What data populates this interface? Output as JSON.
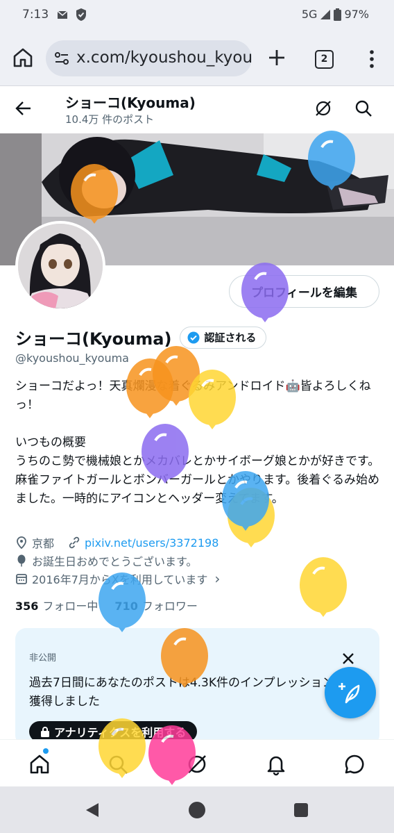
{
  "status_bar": {
    "time": "7:13",
    "network": "5G",
    "battery": "97%"
  },
  "browser": {
    "url": "x.com/kyoushou_kyouma",
    "tab_count": "2"
  },
  "profile_header": {
    "name": "ショーコ(Kyouma)",
    "post_count": "10.4万 件のポスト"
  },
  "profile": {
    "edit_button": "プロフィールを編集",
    "display_name": "ショーコ(Kyouma)",
    "verified_label": "認証される",
    "handle": "@kyoushou_kyouma",
    "bio_line1": "ショーコだよっ！天真爛漫な着ぐるみアンドロイド🤖皆よろしくねっ！",
    "bio_line2": "いつもの概要",
    "bio_line3": "うちのこ勢で機械娘とかメカバレとかサイボーグ娘とかが好きです。麻雀ファイトガールとボンバーガールとかやります。後着ぐるみ始めました。一時的にアイコンとヘッダー変えてます。",
    "location": "京都",
    "website": "pixiv.net/users/3372198",
    "birthday": "お誕生日おめでとうございます。",
    "joined": "2016年7月からXを利用しています",
    "following_count": "356",
    "following_label": "フォロー中",
    "followers_count": "710",
    "followers_label": "フォロワー"
  },
  "analytics_card": {
    "label": "非公開",
    "text": "過去7日間にあなたのポストは4.3K件のインプレッションを獲得しました",
    "button": "アナリティクスを利用する"
  },
  "colors": {
    "accent": "#1d9bf0",
    "card_bg": "#e8f5fd",
    "balloon_orange": "#f7931e",
    "balloon_blue": "#3ea6f0",
    "balloon_purple": "#8b6cf0",
    "balloon_yellow": "#ffd633",
    "balloon_pink": "#ff3d9a"
  }
}
